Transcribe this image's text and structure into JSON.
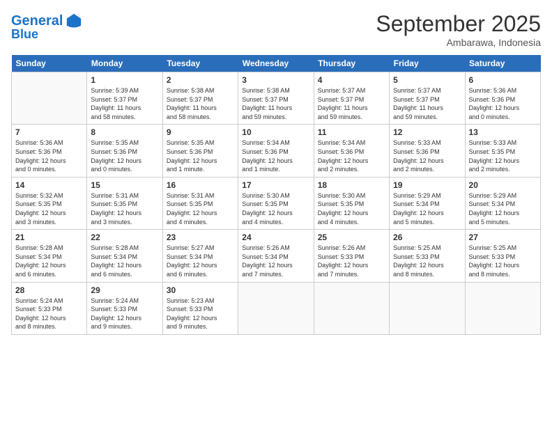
{
  "header": {
    "logo_line1": "General",
    "logo_line2": "Blue",
    "month_title": "September 2025",
    "subtitle": "Ambarawa, Indonesia"
  },
  "days_of_week": [
    "Sunday",
    "Monday",
    "Tuesday",
    "Wednesday",
    "Thursday",
    "Friday",
    "Saturday"
  ],
  "weeks": [
    [
      {
        "day": "",
        "info": ""
      },
      {
        "day": "1",
        "info": "Sunrise: 5:39 AM\nSunset: 5:37 PM\nDaylight: 11 hours\nand 58 minutes."
      },
      {
        "day": "2",
        "info": "Sunrise: 5:38 AM\nSunset: 5:37 PM\nDaylight: 11 hours\nand 58 minutes."
      },
      {
        "day": "3",
        "info": "Sunrise: 5:38 AM\nSunset: 5:37 PM\nDaylight: 11 hours\nand 59 minutes."
      },
      {
        "day": "4",
        "info": "Sunrise: 5:37 AM\nSunset: 5:37 PM\nDaylight: 11 hours\nand 59 minutes."
      },
      {
        "day": "5",
        "info": "Sunrise: 5:37 AM\nSunset: 5:37 PM\nDaylight: 11 hours\nand 59 minutes."
      },
      {
        "day": "6",
        "info": "Sunrise: 5:36 AM\nSunset: 5:36 PM\nDaylight: 12 hours\nand 0 minutes."
      }
    ],
    [
      {
        "day": "7",
        "info": "Sunrise: 5:36 AM\nSunset: 5:36 PM\nDaylight: 12 hours\nand 0 minutes."
      },
      {
        "day": "8",
        "info": "Sunrise: 5:35 AM\nSunset: 5:36 PM\nDaylight: 12 hours\nand 0 minutes."
      },
      {
        "day": "9",
        "info": "Sunrise: 5:35 AM\nSunset: 5:36 PM\nDaylight: 12 hours\nand 1 minute."
      },
      {
        "day": "10",
        "info": "Sunrise: 5:34 AM\nSunset: 5:36 PM\nDaylight: 12 hours\nand 1 minute."
      },
      {
        "day": "11",
        "info": "Sunrise: 5:34 AM\nSunset: 5:36 PM\nDaylight: 12 hours\nand 2 minutes."
      },
      {
        "day": "12",
        "info": "Sunrise: 5:33 AM\nSunset: 5:36 PM\nDaylight: 12 hours\nand 2 minutes."
      },
      {
        "day": "13",
        "info": "Sunrise: 5:33 AM\nSunset: 5:35 PM\nDaylight: 12 hours\nand 2 minutes."
      }
    ],
    [
      {
        "day": "14",
        "info": "Sunrise: 5:32 AM\nSunset: 5:35 PM\nDaylight: 12 hours\nand 3 minutes."
      },
      {
        "day": "15",
        "info": "Sunrise: 5:31 AM\nSunset: 5:35 PM\nDaylight: 12 hours\nand 3 minutes."
      },
      {
        "day": "16",
        "info": "Sunrise: 5:31 AM\nSunset: 5:35 PM\nDaylight: 12 hours\nand 4 minutes."
      },
      {
        "day": "17",
        "info": "Sunrise: 5:30 AM\nSunset: 5:35 PM\nDaylight: 12 hours\nand 4 minutes."
      },
      {
        "day": "18",
        "info": "Sunrise: 5:30 AM\nSunset: 5:35 PM\nDaylight: 12 hours\nand 4 minutes."
      },
      {
        "day": "19",
        "info": "Sunrise: 5:29 AM\nSunset: 5:34 PM\nDaylight: 12 hours\nand 5 minutes."
      },
      {
        "day": "20",
        "info": "Sunrise: 5:29 AM\nSunset: 5:34 PM\nDaylight: 12 hours\nand 5 minutes."
      }
    ],
    [
      {
        "day": "21",
        "info": "Sunrise: 5:28 AM\nSunset: 5:34 PM\nDaylight: 12 hours\nand 6 minutes."
      },
      {
        "day": "22",
        "info": "Sunrise: 5:28 AM\nSunset: 5:34 PM\nDaylight: 12 hours\nand 6 minutes."
      },
      {
        "day": "23",
        "info": "Sunrise: 5:27 AM\nSunset: 5:34 PM\nDaylight: 12 hours\nand 6 minutes."
      },
      {
        "day": "24",
        "info": "Sunrise: 5:26 AM\nSunset: 5:34 PM\nDaylight: 12 hours\nand 7 minutes."
      },
      {
        "day": "25",
        "info": "Sunrise: 5:26 AM\nSunset: 5:33 PM\nDaylight: 12 hours\nand 7 minutes."
      },
      {
        "day": "26",
        "info": "Sunrise: 5:25 AM\nSunset: 5:33 PM\nDaylight: 12 hours\nand 8 minutes."
      },
      {
        "day": "27",
        "info": "Sunrise: 5:25 AM\nSunset: 5:33 PM\nDaylight: 12 hours\nand 8 minutes."
      }
    ],
    [
      {
        "day": "28",
        "info": "Sunrise: 5:24 AM\nSunset: 5:33 PM\nDaylight: 12 hours\nand 8 minutes."
      },
      {
        "day": "29",
        "info": "Sunrise: 5:24 AM\nSunset: 5:33 PM\nDaylight: 12 hours\nand 9 minutes."
      },
      {
        "day": "30",
        "info": "Sunrise: 5:23 AM\nSunset: 5:33 PM\nDaylight: 12 hours\nand 9 minutes."
      },
      {
        "day": "",
        "info": ""
      },
      {
        "day": "",
        "info": ""
      },
      {
        "day": "",
        "info": ""
      },
      {
        "day": "",
        "info": ""
      }
    ]
  ]
}
